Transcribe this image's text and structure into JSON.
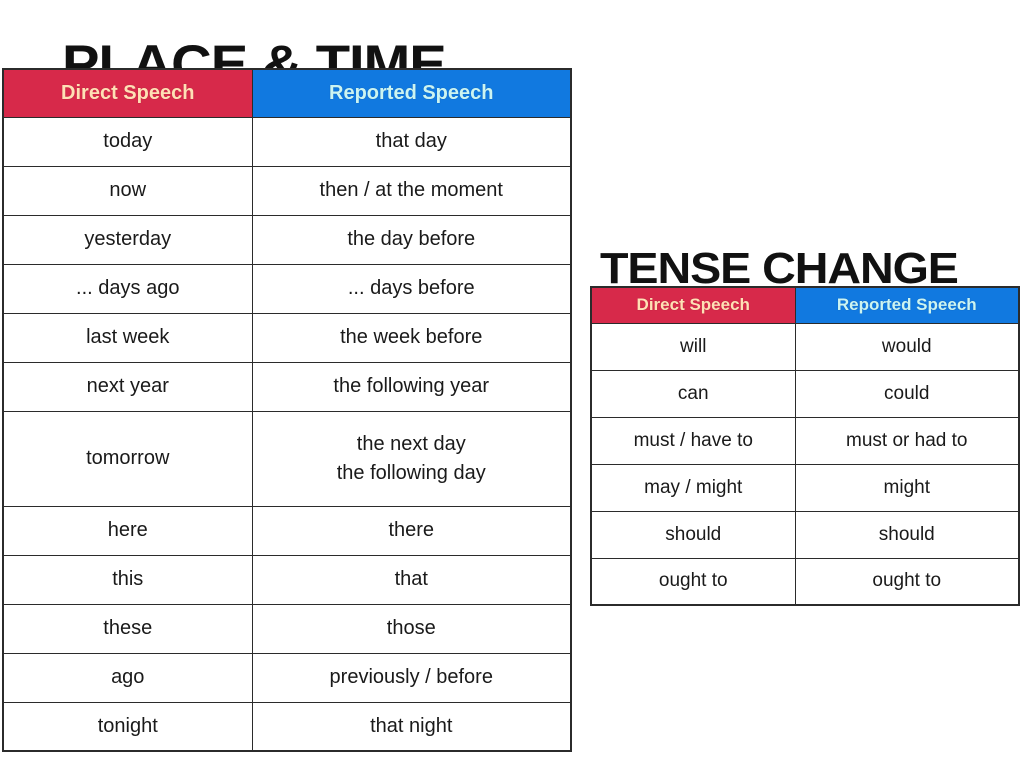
{
  "page": {
    "background_color": "#ffffff",
    "text_color": "#1a1a1a"
  },
  "colors": {
    "direct_header_bg": "#d7294a",
    "direct_header_text": "#ffe0b5",
    "reported_header_bg": "#1179e0",
    "reported_header_text": "#ccf4f1",
    "border": "#2b2b2b"
  },
  "place_time": {
    "title": "PLACE & TIME",
    "columns": [
      "Direct Speech",
      "Reported Speech"
    ],
    "rows": [
      {
        "direct": "today",
        "reported": "that day"
      },
      {
        "direct": "now",
        "reported": "then / at the moment"
      },
      {
        "direct": "yesterday",
        "reported": "the day before"
      },
      {
        "direct": "... days ago",
        "reported": "... days before"
      },
      {
        "direct": "last week",
        "reported": "the week before"
      },
      {
        "direct": "next year",
        "reported": "the following year"
      },
      {
        "direct": "tomorrow",
        "reported_line1": "the next day",
        "reported_line2": "the following day"
      },
      {
        "direct": "here",
        "reported": "there"
      },
      {
        "direct": "this",
        "reported": "that"
      },
      {
        "direct": "these",
        "reported": "those"
      },
      {
        "direct": "ago",
        "reported": "previously / before"
      },
      {
        "direct": "tonight",
        "reported": "that night"
      }
    ]
  },
  "tense_change": {
    "title": "TENSE CHANGE",
    "columns": [
      "Direct Speech",
      "Reported Speech"
    ],
    "rows": [
      {
        "direct": "will",
        "reported": "would"
      },
      {
        "direct": "can",
        "reported": "could"
      },
      {
        "direct": "must / have to",
        "reported": "must or had to"
      },
      {
        "direct": "may / might",
        "reported": "might"
      },
      {
        "direct": "should",
        "reported": "should"
      },
      {
        "direct": "ought to",
        "reported": "ought to"
      }
    ]
  }
}
